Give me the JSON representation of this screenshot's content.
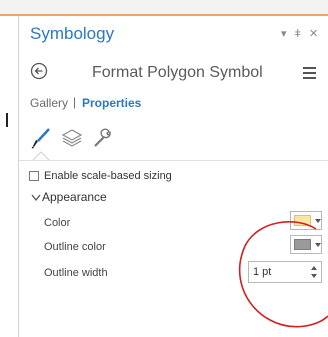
{
  "window": {
    "pane_title": "Symbology",
    "controls": {
      "pin_icon": "pin-icon",
      "close_icon": "close-icon",
      "dropdown_icon": "chevron-down-icon"
    }
  },
  "header": {
    "back_icon": "back-arrow-icon",
    "title": "Format Polygon Symbol",
    "menu_icon": "hamburger-menu-icon"
  },
  "nav": {
    "gallery": "Gallery",
    "separator": "|",
    "properties": "Properties"
  },
  "tabs": [
    {
      "icon": "paintbrush-icon",
      "active": true
    },
    {
      "icon": "layers-icon",
      "active": false
    },
    {
      "icon": "wrench-icon",
      "active": false
    }
  ],
  "options": {
    "scale_sizing_label": "Enable scale-based sizing",
    "scale_sizing_checked": false
  },
  "appearance": {
    "section_title": "Appearance",
    "color_label": "Color",
    "color_value": "#fce6a6",
    "outline_color_label": "Outline color",
    "outline_color_value": "#9a9a9a",
    "outline_width_label": "Outline width",
    "outline_width_value": "1 pt"
  },
  "colors": {
    "accent": "#2a79c4",
    "annotation": "#d02020",
    "top_accent": "#e8a868"
  }
}
